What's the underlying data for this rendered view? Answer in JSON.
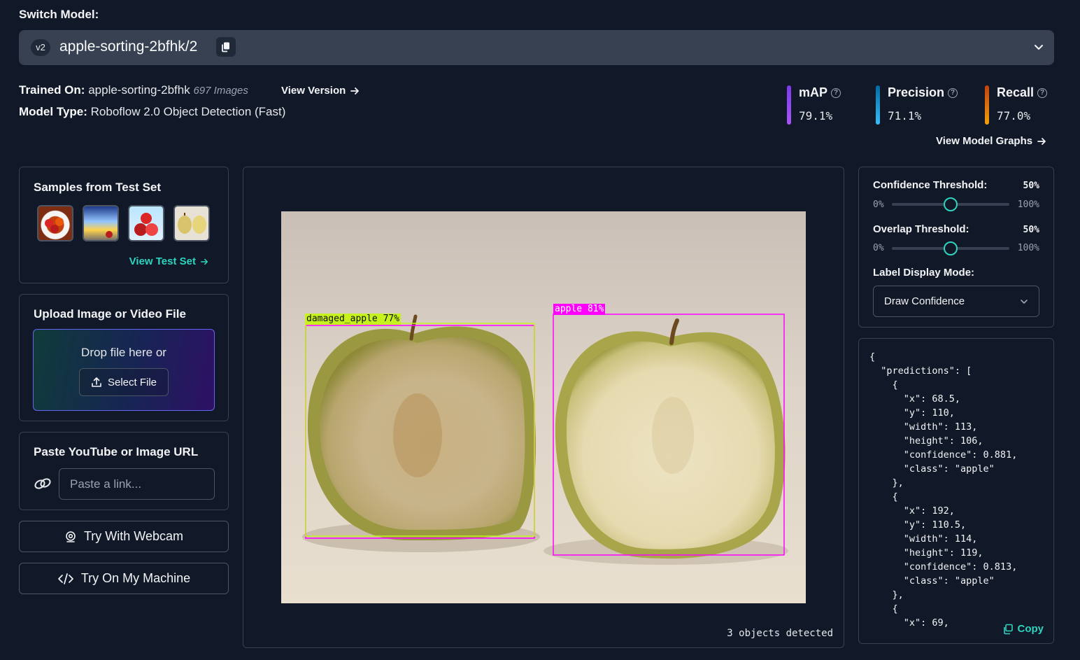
{
  "header": {
    "switch_label": "Switch Model:",
    "version_badge": "v2",
    "model_name": "apple-sorting-2bfhk/2"
  },
  "info": {
    "trained_on_label": "Trained On:",
    "trained_on_value": "apple-sorting-2bfhk",
    "image_count": "697 Images",
    "view_version": "View Version",
    "model_type_label": "Model Type:",
    "model_type_value": "Roboflow 2.0 Object Detection (Fast)"
  },
  "metrics": {
    "map_label": "mAP",
    "map_value": "79.1%",
    "precision_label": "Precision",
    "precision_value": "71.1%",
    "recall_label": "Recall",
    "recall_value": "77.0%",
    "view_graphs": "View Model Graphs",
    "colors": {
      "map": "#a855f7",
      "precision": "#38bdf8",
      "recall": "#f59e0b"
    }
  },
  "samples": {
    "title": "Samples from Test Set",
    "view_test_set": "View Test Set"
  },
  "upload": {
    "title": "Upload Image or Video File",
    "drop_text": "Drop file here or",
    "select_file": "Select File"
  },
  "url": {
    "title": "Paste YouTube or Image URL",
    "placeholder": "Paste a link..."
  },
  "actions": {
    "webcam": "Try With Webcam",
    "machine": "Try On My Machine"
  },
  "preview": {
    "detections": [
      {
        "label": "damaged_apple 77%",
        "color": "#bef264"
      },
      {
        "label": "apple 81%",
        "color": "#ff00ff"
      }
    ],
    "objects_detected": "3 objects detected"
  },
  "controls": {
    "confidence_label": "Confidence Threshold:",
    "confidence_value": "50%",
    "overlap_label": "Overlap Threshold:",
    "overlap_value": "50%",
    "range_min": "0%",
    "range_max": "100%",
    "label_mode_label": "Label Display Mode:",
    "label_mode_value": "Draw Confidence",
    "accent": "#2dd4bf"
  },
  "json_output": {
    "text": "{\n  \"predictions\": [\n    {\n      \"x\": 68.5,\n      \"y\": 110,\n      \"width\": 113,\n      \"height\": 106,\n      \"confidence\": 0.881,\n      \"class\": \"apple\"\n    },\n    {\n      \"x\": 192,\n      \"y\": 110.5,\n      \"width\": 114,\n      \"height\": 119,\n      \"confidence\": 0.813,\n      \"class\": \"apple\"\n    },\n    {\n      \"x\": 69,",
    "copy_label": "Copy"
  }
}
